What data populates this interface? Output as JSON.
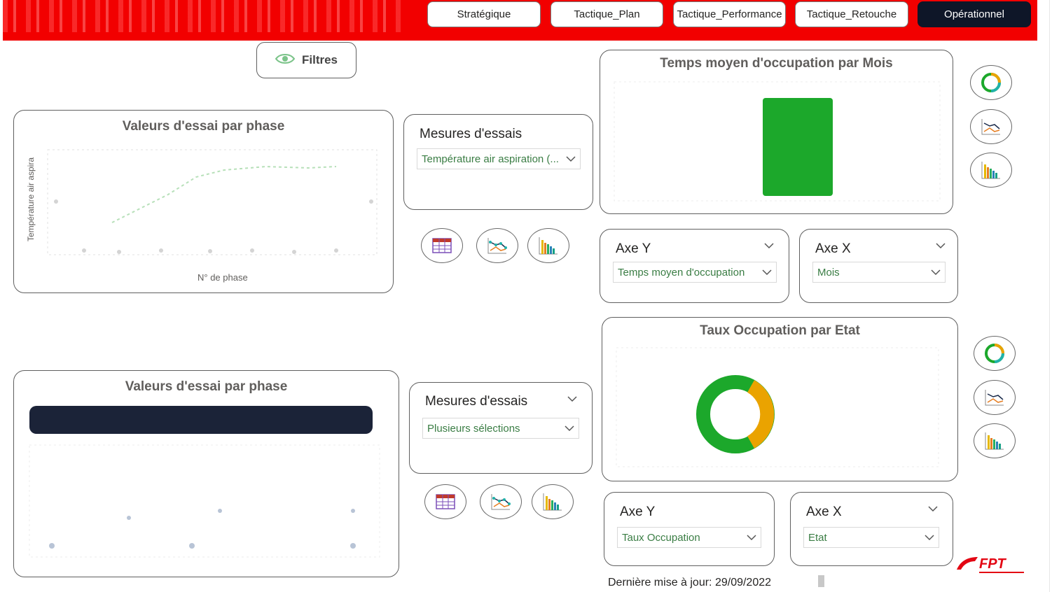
{
  "nav": {
    "tabs": [
      {
        "label": "Stratégique"
      },
      {
        "label": "Tactique_Plan"
      },
      {
        "label": "Tactique_Performance"
      },
      {
        "label": "Tactique_Retouche"
      },
      {
        "label": "Opérationnel"
      }
    ],
    "active": "Opérationnel"
  },
  "filters": {
    "label": "Filtres",
    "icon": "eye-icon"
  },
  "chart_top_left": {
    "title": "Valeurs d'essai par phase",
    "ylabel": "Température air aspira",
    "xlabel": "N° de phase"
  },
  "slicer_top": {
    "title": "Mesures d'essais",
    "selected": "Température air aspiration (..."
  },
  "chart_top_right": {
    "title": "Temps moyen d'occupation par Mois"
  },
  "axis_y_top": {
    "title": "Axe Y",
    "selected": "Temps moyen d'occupation"
  },
  "axis_x_top": {
    "title": "Axe X",
    "selected": "Mois"
  },
  "chart_bottom_left": {
    "title": "Valeurs d'essai par phase"
  },
  "slicer_bottom": {
    "title": "Mesures d'essais",
    "selected": "Plusieurs sélections"
  },
  "chart_bottom_right": {
    "title": "Taux Occupation par Etat"
  },
  "axis_y_bottom": {
    "title": "Axe Y",
    "selected": "Taux Occupation"
  },
  "axis_x_bottom": {
    "title": "Axe X",
    "selected": "Etat"
  },
  "footer": {
    "last_update": "Dernière mise à jour: 29/09/2022"
  },
  "logo": {
    "text": "FPT"
  },
  "colors": {
    "header_red": "#f20000",
    "active_tab": "#0e1628",
    "green": "#1ca82b",
    "orange": "#eaa300",
    "slicer_value": "#3a7d44"
  },
  "icons": [
    "eye-icon",
    "table-icon",
    "line-chart-icon",
    "bar-chart-icon",
    "donut-chart-icon",
    "chevron-down-icon"
  ]
}
